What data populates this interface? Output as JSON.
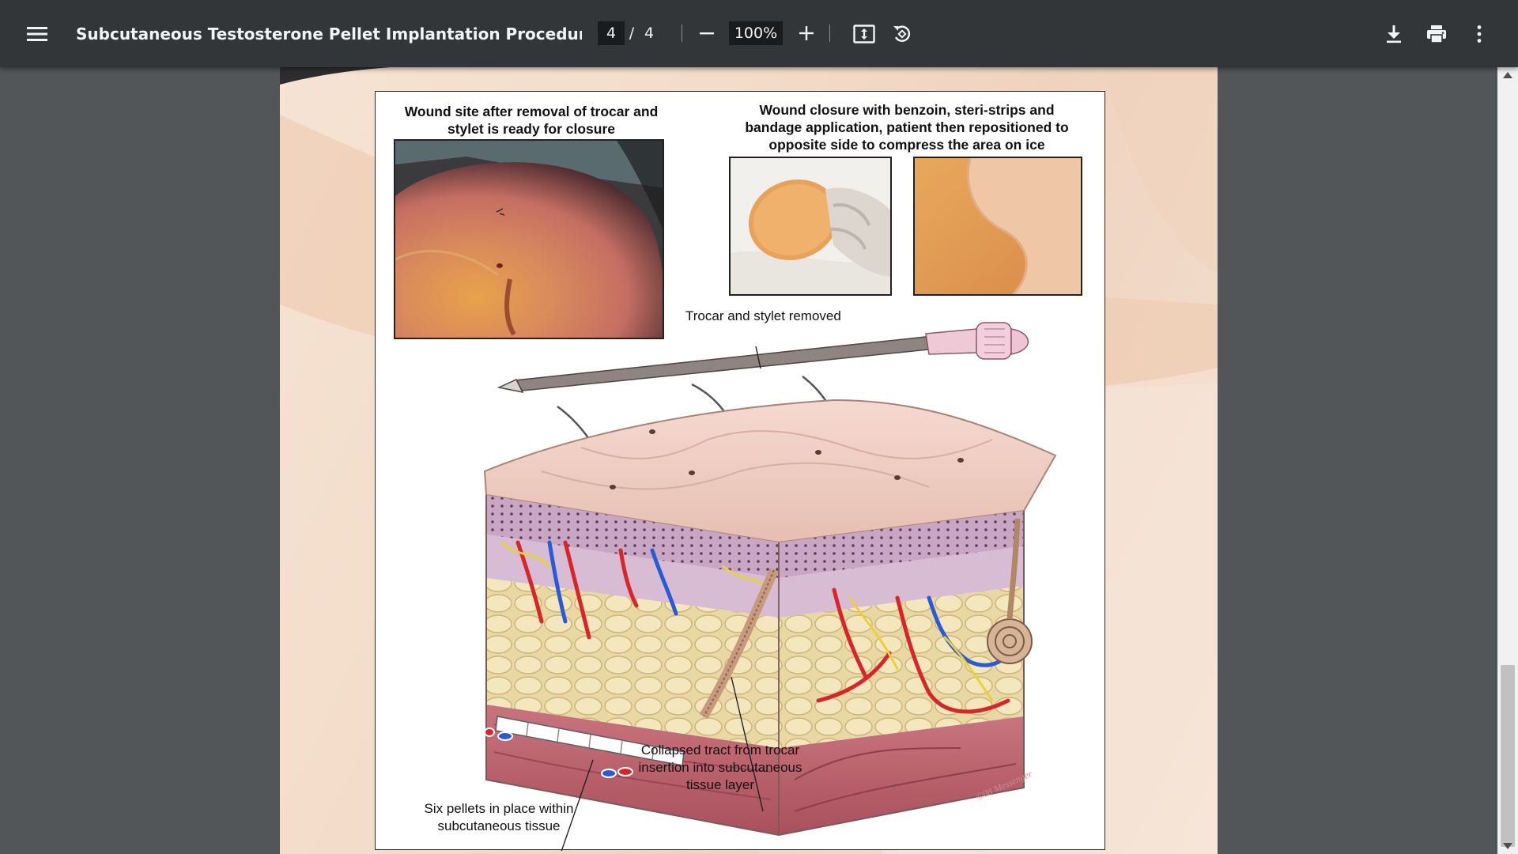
{
  "toolbar": {
    "title": "Subcutaneous Testosterone Pellet Implantation Procedure for Tr...",
    "current_page": "4",
    "page_separator": "/",
    "total_pages": "4",
    "zoom": "100%"
  },
  "figure": {
    "caption_top_left": "Wound site after removal of trocar and stylet is ready for closure",
    "caption_top_right": "Wound closure with benzoin, steri-strips and bandage application, patient then repositioned to opposite side to compress the area on ice",
    "label_trocar": "Trocar and stylet removed",
    "label_tract": "Collapsed tract from trocar insertion into subcutaneous tissue layer",
    "label_pellets": "Six pellets in place within subcutaneous tissue",
    "signature": "©08 Messenger"
  }
}
